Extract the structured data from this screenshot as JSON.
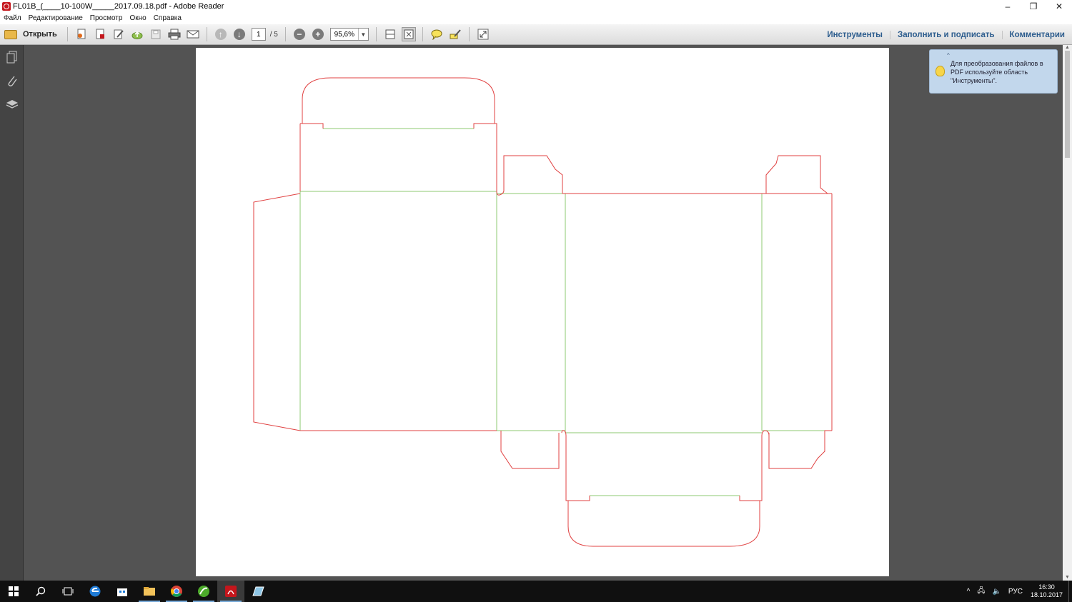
{
  "window": {
    "title": "FL01B_(____10-100W_____2017.09.18.pdf - Adobe Reader",
    "minimize": "–",
    "restore": "❐",
    "close": "✕"
  },
  "menu": [
    "Файл",
    "Редактирование",
    "Просмотр",
    "Окно",
    "Справка"
  ],
  "toolbar": {
    "open_label": "Открыть",
    "page_current": "1",
    "page_total": "/ 5",
    "zoom": "95,6%"
  },
  "panels": [
    "Инструменты",
    "Заполнить и подписать",
    "Комментарии"
  ],
  "tooltip": {
    "text": "Для преобразования файлов в PDF используйте область \"Инструменты\"."
  },
  "taskbar": {
    "language": "РУС",
    "time": "16:30",
    "date": "18.10.2017"
  },
  "colors": {
    "cut_line": "#e04040",
    "fold_line": "#8cc870",
    "link": "#2d5d8e",
    "tooltip_bg": "#c2d7ec"
  }
}
